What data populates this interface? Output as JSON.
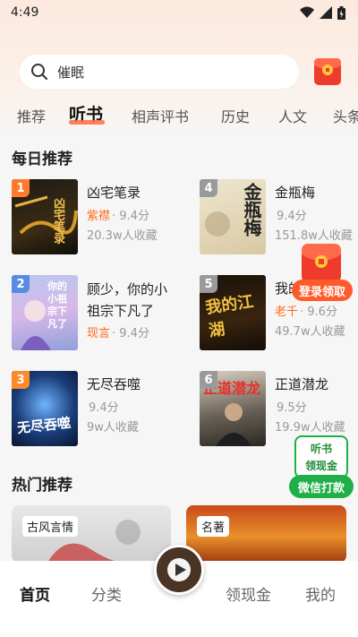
{
  "status_bar": {
    "time": "4:49"
  },
  "search": {
    "query": "催眠"
  },
  "tabs": [
    {
      "label": "推荐"
    },
    {
      "label": "听书"
    },
    {
      "label": "相声评书"
    },
    {
      "label": "历史"
    },
    {
      "label": "人文"
    },
    {
      "label": "头条"
    }
  ],
  "daily": {
    "title": "每日推荐",
    "books": [
      {
        "rank": "1",
        "title": "凶宅笔录",
        "category": "紫襟",
        "score": "· 9.4分",
        "favs": "20.3w人收藏",
        "rank_color": "#ff7a2a",
        "cover_text": "凶宅笔录"
      },
      {
        "rank": "4",
        "title": "金瓶梅",
        "category": "",
        "score": "9.4分",
        "favs": "151.8w人收藏",
        "rank_color": "#9a9a9a",
        "cover_text": "金瓶梅"
      },
      {
        "rank": "2",
        "title": "顾少，你的小祖宗下凡了",
        "category": "现言",
        "score": "· 9.4分",
        "favs": "",
        "rank_color": "#5a8be0",
        "cover_text": "你的小祖宗下凡了"
      },
      {
        "rank": "5",
        "title": "我的",
        "category": "老千",
        "score": "· 9.6分",
        "favs": "49.7w人收藏",
        "rank_color": "#9a9a9a",
        "cover_text": "我的江湖"
      },
      {
        "rank": "3",
        "title": "无尽吞噬",
        "category": "",
        "score": "9.4分",
        "favs": "9w人收藏",
        "rank_color": "#ff8a2a",
        "cover_text": "无尽吞噬"
      },
      {
        "rank": "6",
        "title": "正道潜龙",
        "category": "",
        "score": "9.5分",
        "favs": "19.9w人收藏",
        "rank_color": "#9a9a9a",
        "cover_text": "正道潜龙"
      }
    ]
  },
  "float_redpack": {
    "label": "登录领取"
  },
  "float_wechat": {
    "line1": "听书",
    "line2": "领现金",
    "button": "微信打款"
  },
  "hot": {
    "title": "热门推荐",
    "cards": [
      {
        "tag": "古风言情"
      },
      {
        "tag": "名著"
      }
    ]
  },
  "bottom_nav": [
    {
      "label": "首页"
    },
    {
      "label": "分类"
    },
    {
      "label": "领现金"
    },
    {
      "label": "我的"
    }
  ],
  "colors": {
    "accent": "#ff6a3d",
    "wechat_green": "#1fae48",
    "orange_cat": "#ff6a1a"
  }
}
